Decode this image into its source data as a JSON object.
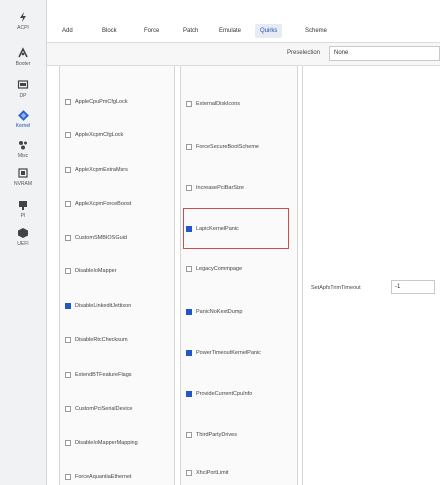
{
  "sidebar": {
    "items": [
      {
        "label": "ACPI",
        "icon": "acpi-icon"
      },
      {
        "label": "Booter",
        "icon": "booter-icon"
      },
      {
        "label": "DP",
        "icon": "dp-icon"
      },
      {
        "label": "Kernel",
        "icon": "kernel-icon",
        "active": true
      },
      {
        "label": "Misc",
        "icon": "misc-icon"
      },
      {
        "label": "NVRAM",
        "icon": "nvram-icon"
      },
      {
        "label": "PI",
        "icon": "pi-icon"
      },
      {
        "label": "UEFI",
        "icon": "uefi-icon"
      }
    ]
  },
  "tabs": [
    "Add",
    "Block",
    "Force",
    "Patch",
    "Emulate",
    "Quirks",
    "Scheme"
  ],
  "active_tab": "Quirks",
  "preselection": {
    "label": "Preselection",
    "value": "None"
  },
  "quirks_left": [
    {
      "label": "AppleCpuPmCfgLock",
      "checked": false
    },
    {
      "label": "AppleXcpmCfgLock",
      "checked": false
    },
    {
      "label": "AppleXcpmExtraMsrs",
      "checked": false
    },
    {
      "label": "AppleXcpmForceBoost",
      "checked": false
    },
    {
      "label": "CustomSMBIOSGuid",
      "checked": false
    },
    {
      "label": "DisableIoMapper",
      "checked": false
    },
    {
      "label": "DisableLinkeditJettison",
      "checked": true
    },
    {
      "label": "DisableRtcChecksum",
      "checked": false
    },
    {
      "label": "ExtendBTFeatureFlags",
      "checked": false
    },
    {
      "label": "CustomPciSerialDevice",
      "checked": false
    },
    {
      "label": "DisableIoMapperMapping",
      "checked": false
    },
    {
      "label": "ForceAquantiaEthernet",
      "checked": false
    }
  ],
  "quirks_mid": [
    {
      "label": "ExternalDiskIcons",
      "checked": false
    },
    {
      "label": "ForceSecureBootScheme",
      "checked": false
    },
    {
      "label": "IncreasePciBarSize",
      "checked": false
    },
    {
      "label": "LapicKernelPanic",
      "checked": true
    },
    {
      "label": "LegacyCommpage",
      "checked": false
    },
    {
      "label": "PanicNoKextDump",
      "checked": true
    },
    {
      "label": "PowerTimeoutKernelPanic",
      "checked": true
    },
    {
      "label": "ProvideCurrentCpuInfo",
      "checked": true
    },
    {
      "label": "ThirdPartyDrives",
      "checked": false
    },
    {
      "label": "XhciPortLimit",
      "checked": false
    }
  ],
  "apfs": {
    "label": "SetApfsTrimTimeout",
    "value": "-1"
  },
  "colors": {
    "accent": "#2357c6",
    "highlight": "#d24a4a"
  }
}
